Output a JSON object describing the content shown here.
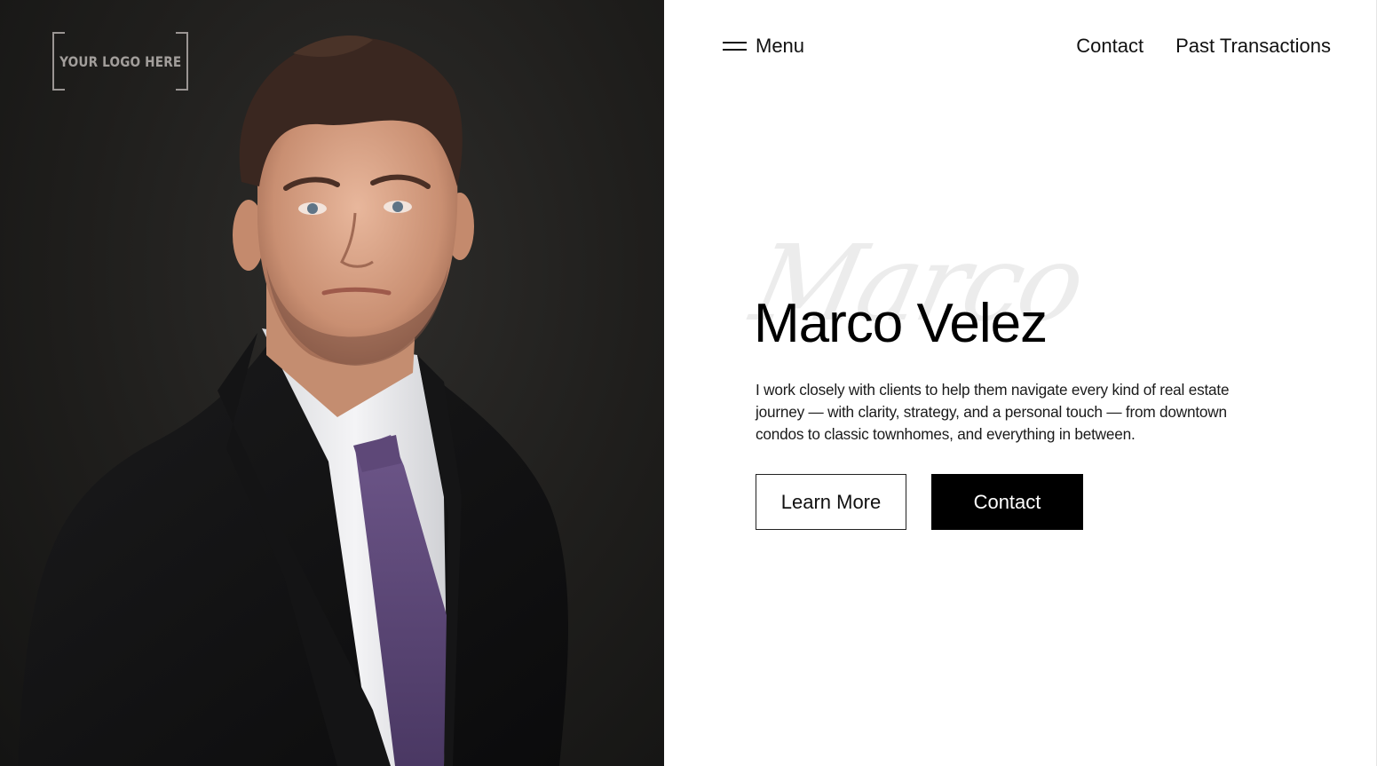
{
  "logo": {
    "text": "YOUR LOGO HERE"
  },
  "header": {
    "menu_label": "Menu",
    "menu_icon": "hamburger-icon",
    "nav": [
      {
        "label": "Contact"
      },
      {
        "label": "Past Transactions"
      }
    ]
  },
  "hero": {
    "script_text": "Marco",
    "name": "Marco Velez",
    "bio": "I work closely with clients to help them navigate every kind of real estate journey — with clarity, strategy, and a personal touch — from downtown condos to classic townhomes, and everything in between.",
    "buttons": {
      "learn_more": "Learn More",
      "contact": "Contact"
    }
  },
  "colors": {
    "photo_background": "#1f1e1c",
    "primary_button": "#000000",
    "text": "#111111",
    "watermark": "#ececec",
    "tie": "#5b4577"
  }
}
